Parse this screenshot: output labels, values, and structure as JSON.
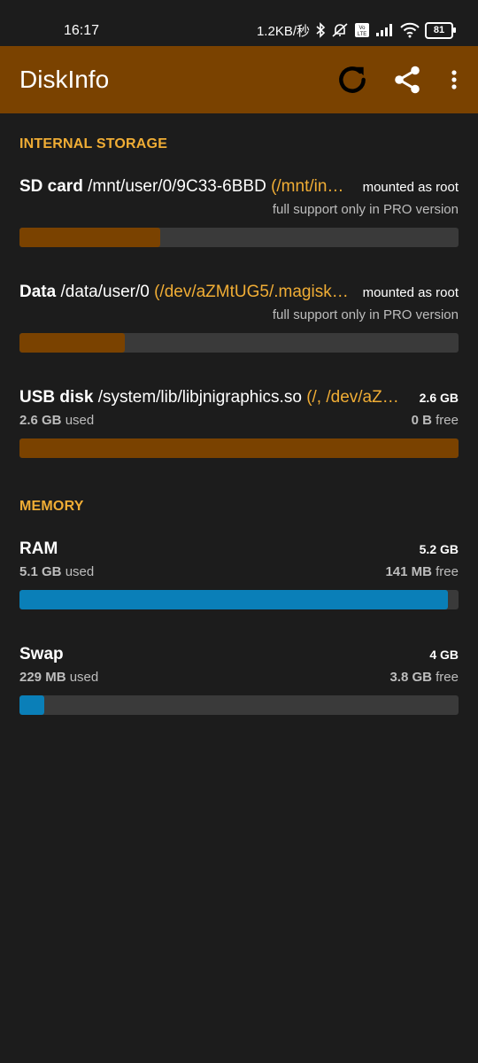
{
  "status": {
    "time": "16:17",
    "net_speed": "1.2KB/秒",
    "battery": "81"
  },
  "appbar": {
    "title": "DiskInfo",
    "icons": [
      "refresh-icon",
      "share-icon",
      "more-vert-icon"
    ]
  },
  "colors": {
    "accent": "#f0ad35",
    "appbar": "#7a4200",
    "memory_bar": "#0a7fb8",
    "background": "#1c1c1c"
  },
  "internal_storage": {
    "header": "INTERNAL STORAGE",
    "items": [
      {
        "name": "SD card",
        "path": "/mnt/user/0/9C33-6BBD",
        "device": "(/mnt/in…",
        "right": "mounted as root",
        "note": "full support only in PRO version",
        "usage_fraction": 0.32
      },
      {
        "name": "Data",
        "path": "/data/user/0",
        "device": "(/dev/aZMtUG5/.magisk…",
        "right": "mounted as root",
        "note": "full support only in PRO version",
        "usage_fraction": 0.24
      },
      {
        "name": "USB disk",
        "path": "/system/lib/libjnigraphics.so",
        "device": "(/, /dev/aZ…",
        "right": "2.6 GB",
        "used_value": "2.6 GB",
        "used_label": "used",
        "free_value": "0 B",
        "free_label": "free",
        "usage_fraction": 1.0
      }
    ]
  },
  "memory": {
    "header": "MEMORY",
    "items": [
      {
        "name": "RAM",
        "total": "5.2 GB",
        "used_value": "5.1 GB",
        "used_label": "used",
        "free_value": "141 MB",
        "free_label": "free",
        "usage_fraction": 0.975
      },
      {
        "name": "Swap",
        "total": "4 GB",
        "used_value": "229 MB",
        "used_label": "used",
        "free_value": "3.8 GB",
        "free_label": "free",
        "usage_fraction": 0.057
      }
    ]
  }
}
